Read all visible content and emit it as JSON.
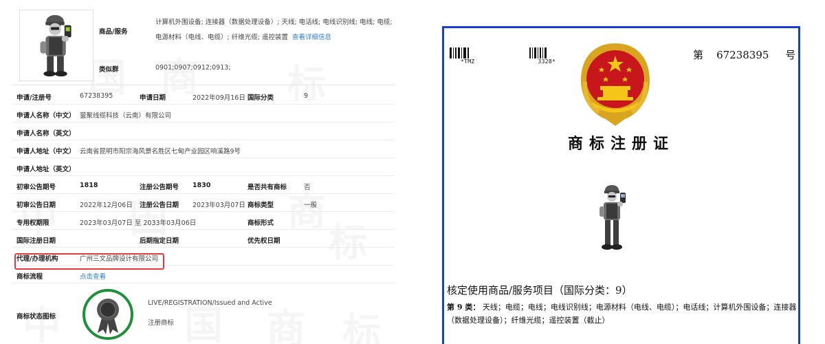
{
  "watermark_chars": [
    "中",
    "国",
    "商",
    "标",
    "中",
    "国",
    "商",
    "标",
    "中",
    "国",
    "商",
    "标"
  ],
  "record": {
    "goods_label": "商品/服务",
    "goods_text": "计算机外围设备; 连接器（数据处理设备）; 天线; 电话线; 电线识别线; 电线; 电缆; 电源材料（电线、电缆）; 纤维光缆; 遥控装置",
    "goods_more_link": "查看详细信息",
    "similar_group_label": "类似群",
    "similar_group_value": "0901;0907;0912;0913;",
    "rows": {
      "reg_no_label": "申请/注册号",
      "reg_no": "67238395",
      "app_date_label": "申请日期",
      "app_date": "2022年09月16日",
      "intl_class_label": "国际分类",
      "intl_class": "9",
      "applicant_cn_label": "申请人名称（中文）",
      "applicant_cn": "萤聚线缆科技（云南）有限公司",
      "applicant_en_label": "申请人名称（英文）",
      "address_cn_label": "申请人地址（中文）",
      "address_cn": "云南省昆明市阳宗海风景名胜区七甸产业园区响溪路9号",
      "address_en_label": "申请人地址（英文）",
      "prelim_no_label": "初审公告期号",
      "prelim_no": "1818",
      "reg_pub_no_label": "注册公告期号",
      "reg_pub_no": "1830",
      "shared_label": "是否共有商标",
      "shared": "否",
      "prelim_date_label": "初审公告日期",
      "prelim_date": "2022年12月06日",
      "reg_pub_date_label": "注册公告日期",
      "reg_pub_date": "2023年03月07日",
      "mark_type_label": "商标类型",
      "mark_type": "一般",
      "exclusive_label": "专用权期限",
      "exclusive": "2023年03月07日 至 2033年03月06日",
      "mark_form_label": "商标形式",
      "intl_reg_date_label": "国际注册日期",
      "later_date_label": "后期指定日期",
      "priority_date_label": "优先权日期",
      "agent_label": "代理/办理机构",
      "agent": "广州三文品牌设计有限公司",
      "process_label": "商标流程",
      "process_link": "点击查看",
      "status_label": "商标状态图标",
      "status_en": "LIVE/REGISTRATION/Issued and Active",
      "status_cn": "注册商标"
    }
  },
  "certificate": {
    "barcode_text": "*TMZ                  3328*",
    "reg_no_prefix": "第",
    "reg_no": "67238395",
    "reg_no_suffix": "号",
    "title": "商标注册证",
    "subtitle": "核定使用商品/服务项目（国际分类：9）",
    "class_label": "第 9 类：",
    "class_text": "天线；电缆；电线；电线识别线；电源材料（电线、电缆）；电话线；计算机外围设备；连接器（数据处理设备）；纤维光缆；遥控装置（截止）"
  },
  "colors": {
    "link": "#2f7bd3",
    "highlight_border": "#e03a3a",
    "cert_border": "#1a3fcf",
    "status_ring": "#1f8f3a"
  }
}
